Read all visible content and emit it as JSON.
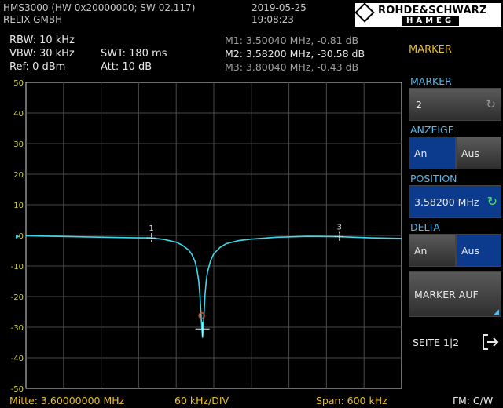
{
  "header": {
    "device": "HMS3000 (HW 0x20000000; SW 02.117)",
    "owner": "RELIX GMBH",
    "date": "2019-05-25",
    "time": "19:08:23",
    "logo_top": "ROHDE&SCHWARZ",
    "logo_bottom": "HAMEG"
  },
  "settings": {
    "rbw": "RBW: 10 kHz",
    "vbw": "VBW: 30 kHz",
    "ref": "Ref: 0 dBm",
    "swt": "SWT: 180 ms",
    "att": "Att: 10 dB"
  },
  "markers": [
    {
      "label": "M1: 3.50040 MHz, -0.81 dB",
      "id": "1",
      "freq_mhz": 3.5004,
      "level_db": -0.81,
      "active": false
    },
    {
      "label": "M2: 3.58200 MHz, -30.58 dB",
      "id": "2",
      "freq_mhz": 3.582,
      "level_db": -30.58,
      "active": true
    },
    {
      "label": "M3: 3.80040 MHz, -0.43 dB",
      "id": "3",
      "freq_mhz": 3.8004,
      "level_db": -0.43,
      "active": false
    }
  ],
  "chart_data": {
    "type": "line",
    "x_range_mhz": [
      3.3,
      3.9
    ],
    "ylim": [
      -50,
      50
    ],
    "y_ticks": [
      "50",
      "40",
      "30",
      "20",
      "10",
      "0",
      "-10",
      "-20",
      "-30",
      "-40",
      "-50"
    ],
    "grid": true,
    "series": [
      {
        "color": "#3fd8e8",
        "x": [
          3.3,
          3.35,
          3.4,
          3.45,
          3.48,
          3.5,
          3.52,
          3.54,
          3.55,
          3.56,
          3.565,
          3.57,
          3.573,
          3.576,
          3.578,
          3.58,
          3.582,
          3.584,
          3.586,
          3.588,
          3.59,
          3.595,
          3.6,
          3.61,
          3.62,
          3.64,
          3.66,
          3.7,
          3.75,
          3.8,
          3.85,
          3.9
        ],
        "y": [
          -0.1,
          -0.3,
          -0.5,
          -0.7,
          -0.8,
          -0.8,
          -1.3,
          -2.2,
          -3.2,
          -4.8,
          -6.2,
          -8.5,
          -11.0,
          -15.0,
          -20.0,
          -27.5,
          -33.5,
          -27.0,
          -19.5,
          -15.0,
          -12.0,
          -8.2,
          -6.0,
          -3.9,
          -2.7,
          -1.7,
          -1.2,
          -0.6,
          -0.3,
          -0.4,
          -0.8,
          -1.0
        ]
      }
    ]
  },
  "footer": {
    "center": "Mitte: 3.60000000 MHz",
    "div": "60 kHz/DIV",
    "span": "Span: 600 kHz",
    "mode": "ΓM: C/W"
  },
  "softkeys": {
    "menu_title": "MARKER",
    "marker_title": "MARKER",
    "marker_value": "2",
    "anzeige_title": "ANZEIGE",
    "anzeige_on": "An",
    "anzeige_off": "Aus",
    "position_title": "POSITION",
    "position_value": "3.58200 MHz",
    "delta_title": "DELTA",
    "delta_on": "An",
    "delta_off": "Aus",
    "marker_auf": "MARKER AUF",
    "page": "SEITE 1|2"
  }
}
